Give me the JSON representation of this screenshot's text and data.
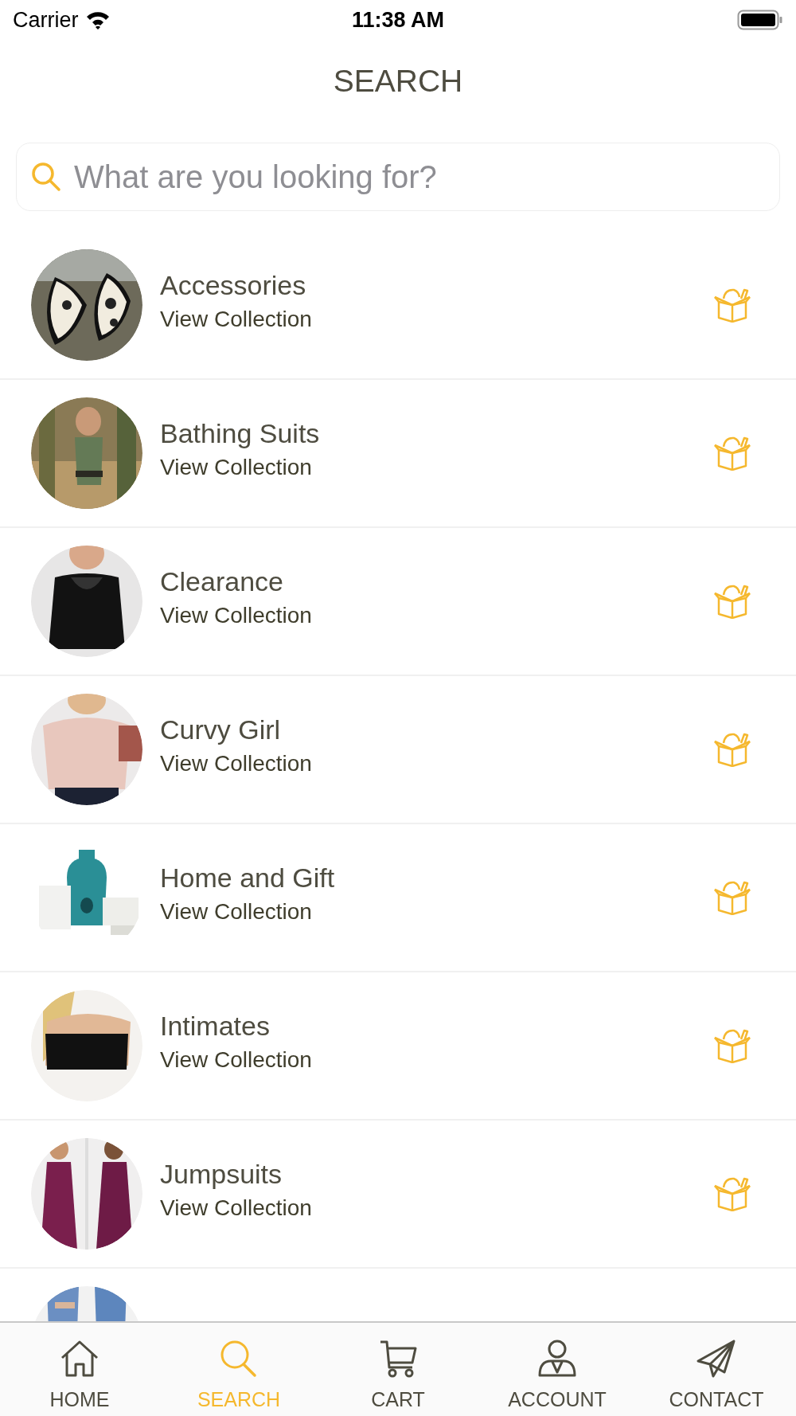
{
  "status_bar": {
    "carrier": "Carrier",
    "time": "11:38 AM"
  },
  "title": "SEARCH",
  "search": {
    "placeholder": "What are you looking for?"
  },
  "collections": [
    {
      "kind": "collection",
      "name": "Accessories",
      "link": "View Collection"
    },
    {
      "kind": "collection",
      "name": "Bathing Suits",
      "link": "View Collection"
    },
    {
      "kind": "collection",
      "name": "Clearance",
      "link": "View Collection"
    },
    {
      "kind": "collection",
      "name": "Curvy Girl",
      "link": "View Collection"
    },
    {
      "kind": "collection",
      "name": "Home and Gift",
      "link": "View Collection"
    },
    {
      "kind": "collection",
      "name": "Intimates",
      "link": "View Collection"
    },
    {
      "kind": "collection",
      "name": "Jumpsuits",
      "link": "View Collection"
    },
    {
      "kind": "picture"
    }
  ],
  "tabs": [
    {
      "label": "HOME",
      "kind": "home",
      "selected": false
    },
    {
      "label": "SEARCH",
      "kind": "search",
      "selected": true
    },
    {
      "label": "CART",
      "kind": "cart",
      "selected": false
    },
    {
      "label": "ACCOUNT",
      "kind": "account",
      "selected": false
    },
    {
      "label": "CONTACT",
      "kind": "contact",
      "selected": false
    }
  ]
}
